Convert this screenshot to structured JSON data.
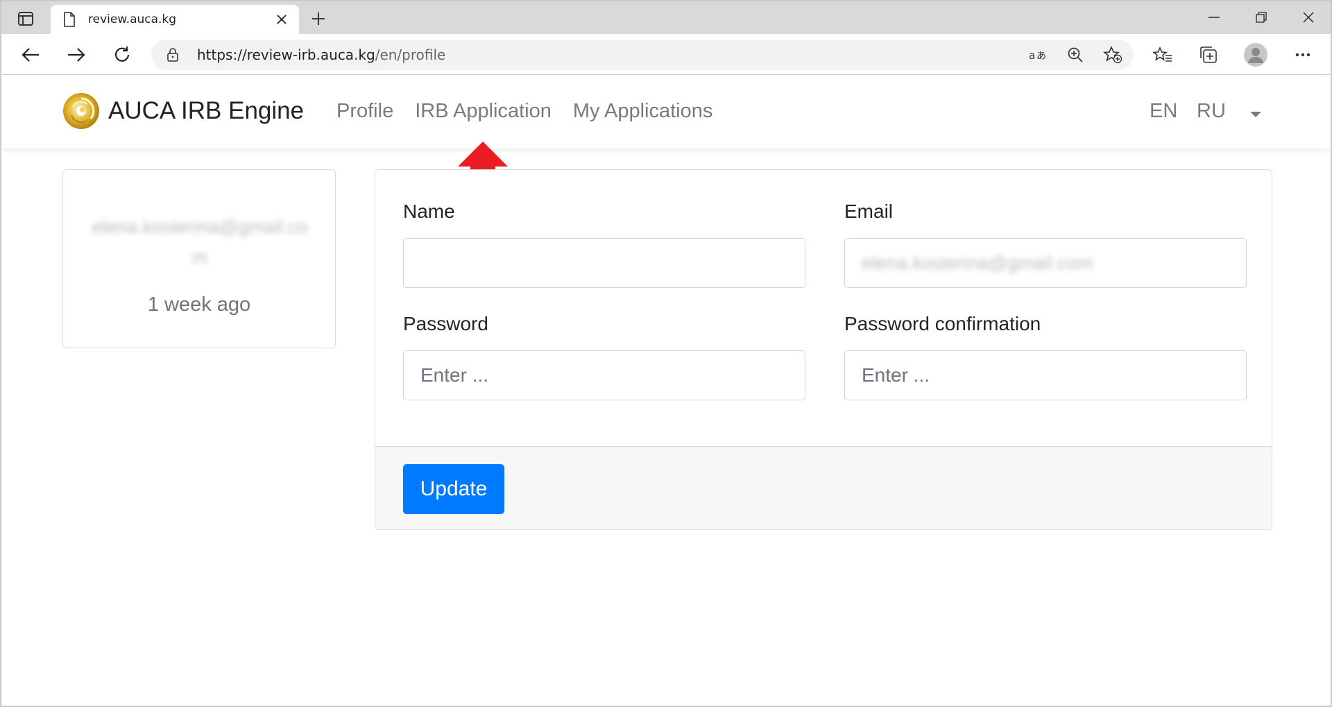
{
  "browser": {
    "tab_title": "review.auca.kg",
    "url_host": "https://review-irb.auca.kg",
    "url_path": "/en/profile"
  },
  "navbar": {
    "brand": "AUCA IRB Engine",
    "links": [
      "Profile",
      "IRB Application",
      "My Applications"
    ],
    "lang_en": "EN",
    "lang_ru": "RU"
  },
  "profile_card": {
    "email": "elena.kosterina@gmail.com",
    "time_ago": "1 week ago"
  },
  "form": {
    "name_label": "Name",
    "name_value": "",
    "email_label": "Email",
    "email_value": "elena.kosterina@gmail.com",
    "password_label": "Password",
    "password_placeholder": "Enter ...",
    "password_confirmation_label": "Password confirmation",
    "password_confirmation_placeholder": "Enter ...",
    "update_button": "Update"
  },
  "colors": {
    "primary": "#007bff",
    "annotation_arrow": "#ec1c24",
    "brand_gold": "#d4a91e"
  },
  "icons": [
    "tab-actions-icon",
    "page-icon",
    "close-icon",
    "plus-icon",
    "minimize-icon",
    "restore-icon",
    "close-window-icon",
    "back-icon",
    "forward-icon",
    "refresh-icon",
    "lock-icon",
    "read-aloud-icon",
    "zoom-icon",
    "add-favorite-icon",
    "favorites-icon",
    "collections-icon",
    "profile-avatar-icon",
    "more-icon",
    "caret-down-icon"
  ]
}
